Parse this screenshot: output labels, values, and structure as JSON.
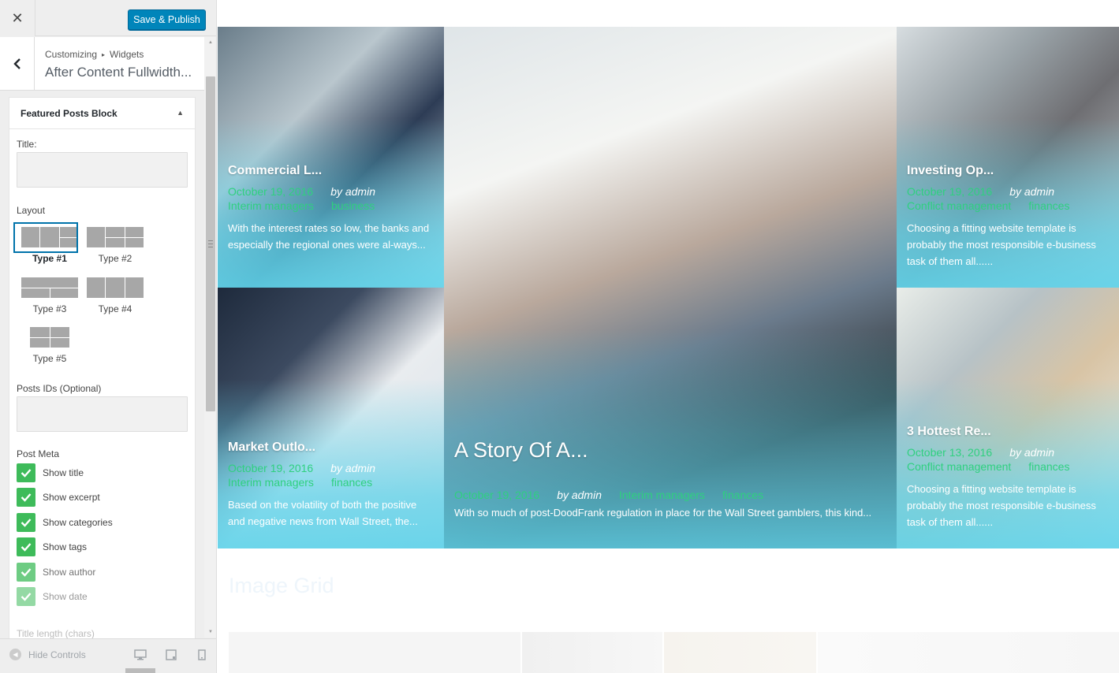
{
  "topbar": {
    "close_glyph": "✕",
    "publish_label": "Save & Publish"
  },
  "panel": {
    "breadcrumb_root": "Customizing",
    "breadcrumb_sep": "▸",
    "breadcrumb_section": "Widgets",
    "title": "After Content Fullwidth..."
  },
  "widget": {
    "title": "Featured Posts Block",
    "toggle_glyph": "▲",
    "title_label": "Title:",
    "title_value": "",
    "layout_label": "Layout",
    "layouts": [
      "Type #1",
      "Type #2",
      "Type #3",
      "Type #4",
      "Type #5"
    ],
    "selected_layout": "Type #1",
    "post_ids_label": "Posts IDs (Optional)",
    "post_ids_value": "",
    "post_meta_label": "Post Meta",
    "post_meta": [
      "Show title",
      "Show excerpt",
      "Show categories",
      "Show tags",
      "Show author",
      "Show date"
    ],
    "title_length_label": "Title length (chars)"
  },
  "bottom": {
    "hide_controls": "Hide Controls",
    "hide_icon_glyph": "◀"
  },
  "preview": {
    "posts": [
      {
        "title": "Commercial L...",
        "date": "October 19, 2016",
        "author": "by admin",
        "categories": [
          "Interim managers",
          "business"
        ],
        "excerpt": "With the interest rates so low, the banks and especially the regional ones were al-ways..."
      },
      {
        "title": "A Story Of A...",
        "date": "October 19, 2016",
        "author": "by admin",
        "categories": [
          "Interim managers",
          "finances"
        ],
        "excerpt": "With so much of post-DoodFrank regulation in place for the Wall Street gamblers, this kind..."
      },
      {
        "title": "Investing Op...",
        "date": "October 19, 2016",
        "author": "by admin",
        "categories": [
          "Conflict management",
          "finances"
        ],
        "excerpt": "Choosing a fitting website template is probably the most responsible e-business task of them all......"
      },
      {
        "title": "Market Outlo...",
        "date": "October 19, 2016",
        "author": "by admin",
        "categories": [
          "Interim managers",
          "finances"
        ],
        "excerpt": "Based on the volatility of both the positive and negative news from Wall Street, the..."
      },
      {
        "title": "3 Hottest Re...",
        "date": "October 13, 2016",
        "author": "by admin",
        "categories": [
          "Conflict management",
          "finances"
        ],
        "excerpt": "Choosing a fitting website template is probably the most responsible e-business task of them all......"
      }
    ],
    "image_grid_heading": "Image Grid"
  },
  "colors": {
    "accent": "#0085ba",
    "checkbox": "#3ebb5a",
    "meta_green": "#2fd07f",
    "overlay_cyan": "#5fd3ea"
  }
}
